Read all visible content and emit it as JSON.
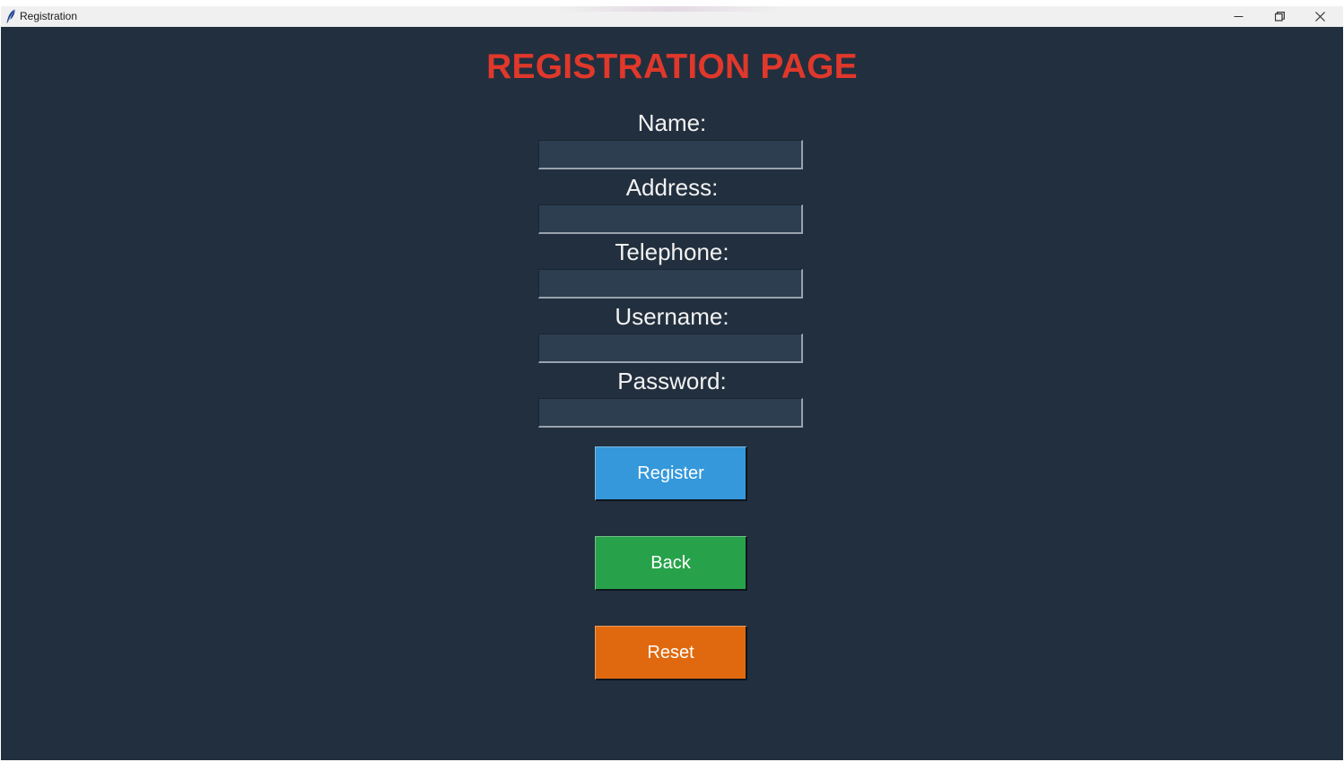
{
  "window": {
    "title": "Registration",
    "controls": {
      "minimize": "minimize-icon",
      "maximize": "restore-icon",
      "close": "close-icon"
    }
  },
  "page": {
    "heading": "REGISTRATION PAGE"
  },
  "form": {
    "fields": [
      {
        "label": "Name:",
        "value": ""
      },
      {
        "label": "Address:",
        "value": ""
      },
      {
        "label": "Telephone:",
        "value": ""
      },
      {
        "label": "Username:",
        "value": ""
      },
      {
        "label": "Password:",
        "value": ""
      }
    ]
  },
  "buttons": {
    "register": "Register",
    "back": "Back",
    "reset": "Reset"
  },
  "colors": {
    "background": "#222f3e",
    "heading": "#e0382b",
    "input_background": "#2c3e50",
    "register": "#3498db",
    "back": "#27a24a",
    "reset": "#e0690f"
  }
}
